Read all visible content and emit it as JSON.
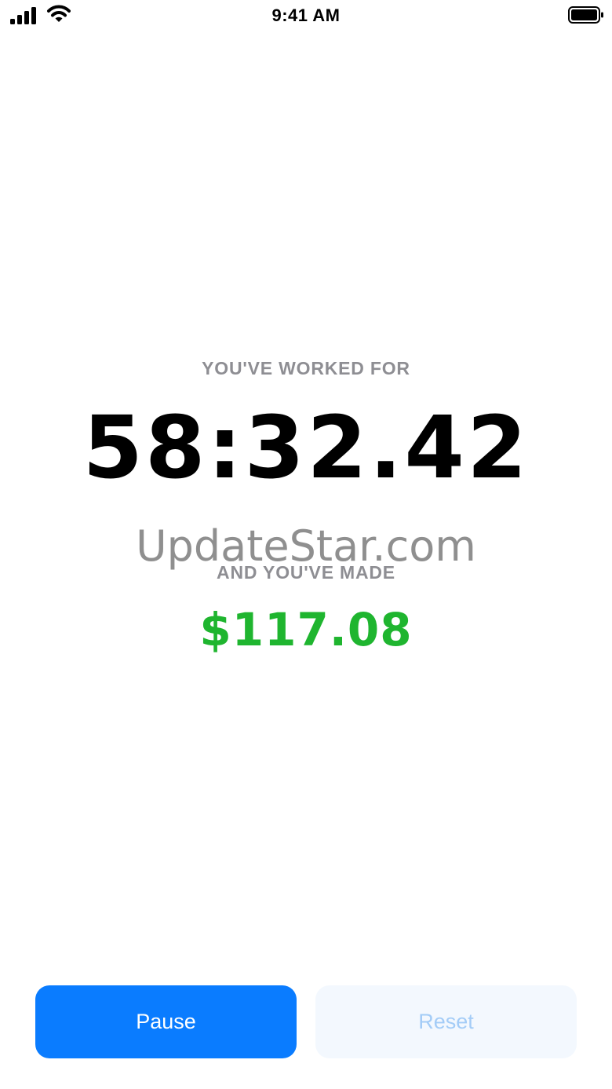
{
  "status_bar": {
    "time": "9:41 AM",
    "signal_icon": "cellular-signal-icon",
    "wifi_icon": "wifi-icon",
    "battery_icon": "battery-icon"
  },
  "timer": {
    "label": "YOU'VE WORKED FOR",
    "elapsed": "58:32.42"
  },
  "earnings": {
    "label": "AND YOU'VE MADE",
    "amount": "$117.08",
    "color": "#1fb52f"
  },
  "watermark": "UpdateStar.com",
  "buttons": {
    "pause_label": "Pause",
    "reset_label": "Reset",
    "pause_color": "#0a7cff",
    "reset_color": "#a3ccf7"
  }
}
